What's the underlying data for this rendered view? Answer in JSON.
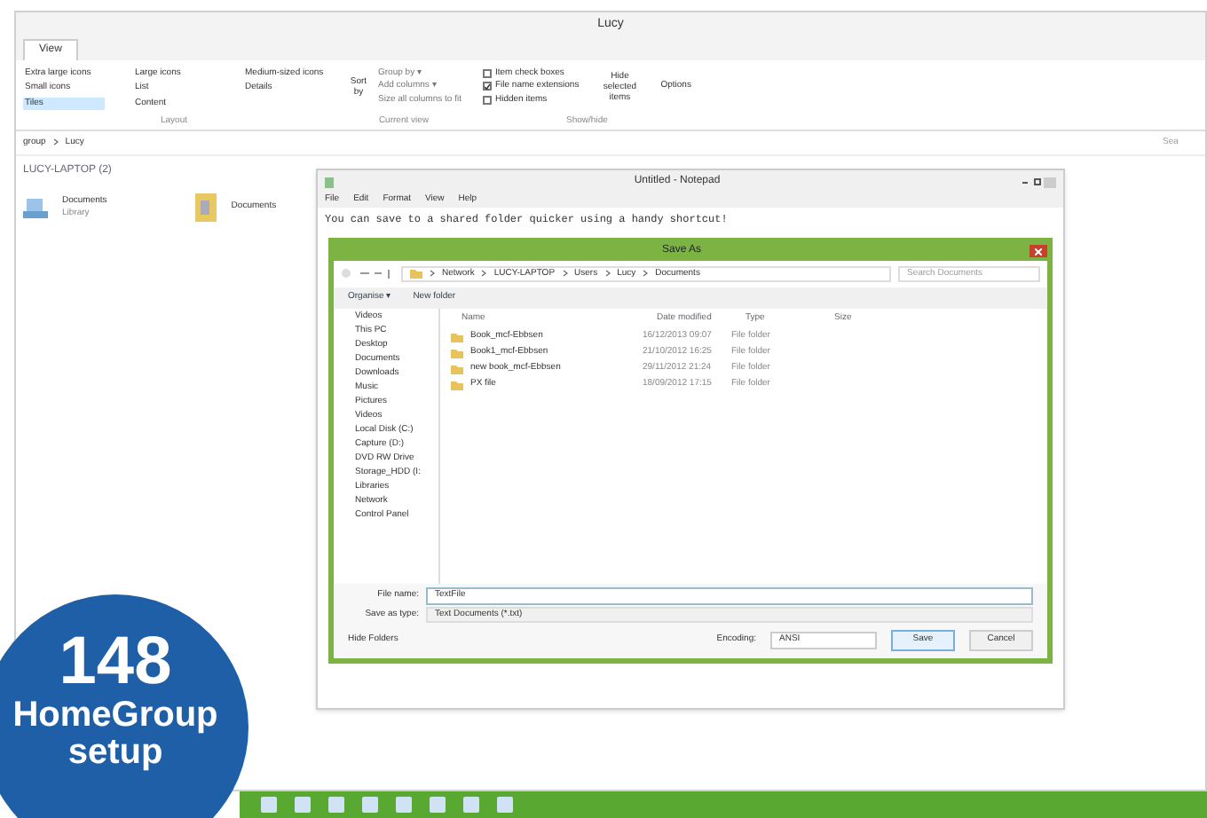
{
  "explorer": {
    "title": "Lucy",
    "tabs": [
      {
        "label": "View",
        "selected": true
      }
    ],
    "layout_options": [
      {
        "label": "Extra large icons",
        "selected": false
      },
      {
        "label": "Large icons",
        "selected": false
      },
      {
        "label": "Medium-sized icons",
        "selected": false
      },
      {
        "label": "Small icons",
        "selected": false
      },
      {
        "label": "List",
        "selected": false
      },
      {
        "label": "Details",
        "selected": false
      },
      {
        "label": "Tiles",
        "selected": true
      },
      {
        "label": "Content",
        "selected": false
      }
    ],
    "sort_button": "Sort by",
    "current_view": [
      "Group by ▾",
      "Add columns ▾",
      "Size all columns to fit"
    ],
    "show_hide": [
      {
        "label": "Item check boxes",
        "checked": false
      },
      {
        "label": "File name extensions",
        "checked": true
      },
      {
        "label": "Hidden items",
        "checked": false
      }
    ],
    "hide_button": "Hide selected items",
    "options_button": "Options",
    "group_labels": [
      "Layout",
      "Current view",
      "Show/hide"
    ],
    "breadcrumb": [
      "group",
      "Lucy"
    ],
    "search_placeholder": "Sea",
    "section_header": "LUCY-LAPTOP (2)",
    "items": [
      {
        "kind": "library",
        "name": "Documents",
        "subtitle": "Library"
      },
      {
        "kind": "folder",
        "name": "Documents"
      }
    ]
  },
  "notepad": {
    "title": "Untitled - Notepad",
    "menu": [
      "File",
      "Edit",
      "Format",
      "View",
      "Help"
    ],
    "text": "You can save to a shared folder quicker using a handy shortcut!"
  },
  "save_as": {
    "title": "Save As",
    "path": [
      "Network",
      "LUCY-LAPTOP",
      "Users",
      "Lucy",
      "Documents"
    ],
    "search_placeholder": "Search Documents",
    "toolbar": [
      "Organise ▾",
      "New folder"
    ],
    "nav": [
      "Videos",
      "This PC",
      "Desktop",
      "Documents",
      "Downloads",
      "Music",
      "Pictures",
      "Videos",
      "Local Disk (C:)",
      "Capture (D:)",
      "DVD RW Drive",
      "Storage_HDD (I:",
      "Libraries",
      "Network",
      "Control Panel"
    ],
    "columns": [
      "Name",
      "Date modified",
      "Type",
      "Size"
    ],
    "rows": [
      {
        "name": "Book_mcf-Ebbsen",
        "date": "16/12/2013 09:07",
        "type": "File folder"
      },
      {
        "name": "Book1_mcf-Ebbsen",
        "date": "21/10/2012 16:25",
        "type": "File folder"
      },
      {
        "name": "new book_mcf-Ebbsen",
        "date": "29/11/2012 21:24",
        "type": "File folder"
      },
      {
        "name": "PX file",
        "date": "18/09/2012 17:15",
        "type": "File folder"
      }
    ],
    "file_name_label": "File name:",
    "file_name": "TextFile",
    "type_label": "Save as type:",
    "type_value": "Text Documents (*.txt)",
    "hide_folders": "Hide Folders",
    "encoding_label": "Encoding:",
    "encoding": "ANSI",
    "save": "Save",
    "cancel": "Cancel"
  },
  "badge": {
    "number": "148",
    "caption": "HomeGroup setup"
  }
}
